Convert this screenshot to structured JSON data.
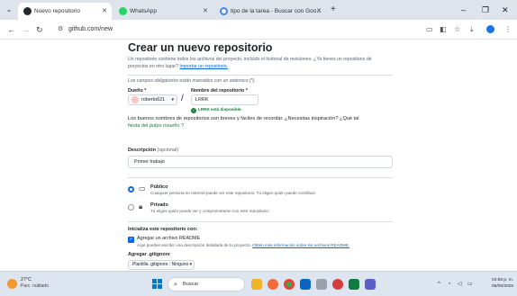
{
  "browser": {
    "tabs": [
      {
        "title": "Nuevo repositorio",
        "favicon": "github-icon",
        "active": true
      },
      {
        "title": "WhatsApp",
        "favicon": "whatsapp-icon",
        "active": false
      },
      {
        "title": "tipo de la tarea - Buscar con Goo...",
        "favicon": "google-icon",
        "active": false
      }
    ],
    "new_tab_label": "+",
    "url": "github.com/new",
    "window_controls": {
      "minimize": "–",
      "restore": "❐",
      "close": "✕"
    }
  },
  "page": {
    "title": "Crear un nuevo repositorio",
    "subtitle": "Un repositorio contiene todos los archivos del proyecto, incluido el historial de revisiones. ¿Ya tienes un repositorio de proyectos en otro lugar?",
    "import_link": "Importar un repositorio.",
    "required_note": "Los campos obligatorios están marcados con un asterisco (*).",
    "owner_label": "Dueño *",
    "owner_value": "roberto621",
    "repo_label": "Nombre del repositorio *",
    "repo_value": "LRRK",
    "availability": "LRRK está disponible.",
    "name_hint": "Los buenos nombres de repositorios son breves y fáciles de recordar. ¿Necesitas inspiración? ¿Qué tal",
    "name_suggestion": "fiesta del pulpo risueño ?",
    "description_label": "Descripción",
    "description_optional": "(opcional)",
    "description_value": "Primer trabajo",
    "visibility": [
      {
        "title": "Público",
        "desc": "Cualquier persona en Internet puede ver este repositorio. Tú eliges quién puede contribuir.",
        "selected": true,
        "icon": "public-repo-icon"
      },
      {
        "title": "Privado",
        "desc": "Tú eliges quién puede ver y comprometerse con este repositorio.",
        "selected": false,
        "icon": "lock-icon"
      }
    ],
    "init_heading": "Inicializa este repositorio con:",
    "readme_label": "Agregar un archivo README",
    "readme_desc": "Aquí puedes escribir una descripción detallada de tu proyecto.",
    "readme_link": "Obtén más información sobre los archivos README.",
    "readme_checked": true,
    "gitignore_heading": "Agregar .gitignore",
    "gitignore_select": "Plantilla .gitignore : Ninguno ▾"
  },
  "taskbar": {
    "weather_temp": "27°C",
    "weather_cond": "Parc. nublado",
    "search_placeholder": "Buscar",
    "time": "04:58 p. m.",
    "date": "06/05/2025"
  },
  "colors": {
    "accent": "#0969da",
    "success": "#1a7f37",
    "tabstrip": "#dfe3eb",
    "taskbar": "#dde5f1"
  }
}
